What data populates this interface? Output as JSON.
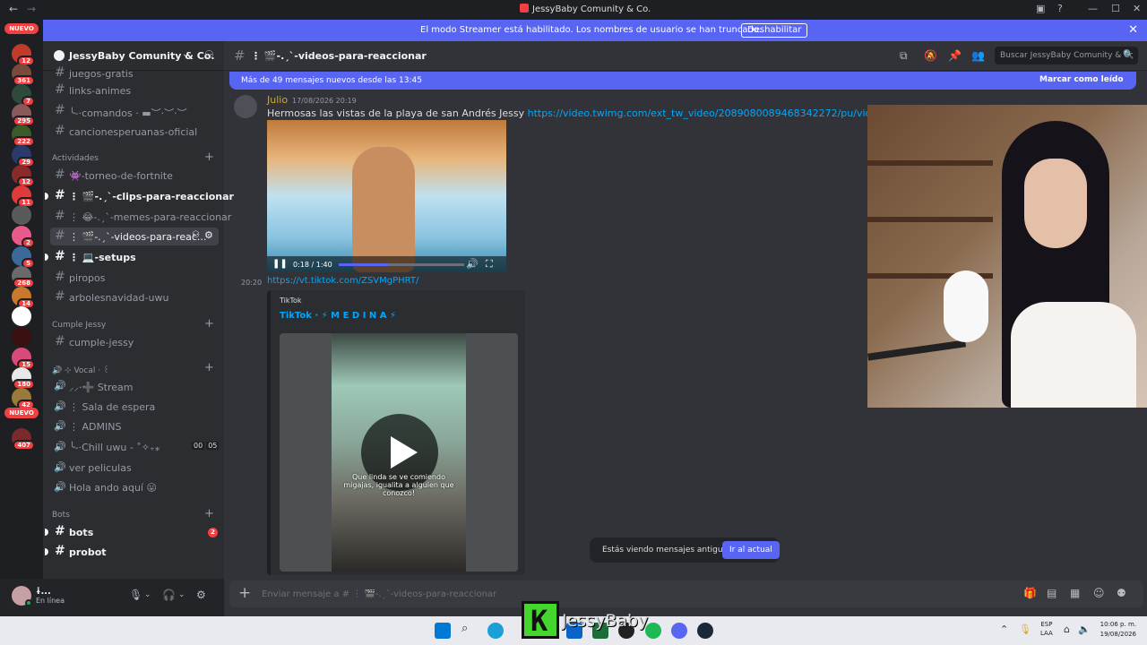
{
  "window": {
    "title": "JessyBaby Comunity & Co."
  },
  "streamer_banner": {
    "text": "El modo Streamer está habilitado. Los nombres de usuario se han truncado.",
    "button": "Deshabilitar"
  },
  "servers": [
    {
      "badge": "NUEVO",
      "type": "tag"
    },
    {
      "badge": "12",
      "color": "#c23a2a"
    },
    {
      "badge": "361",
      "color": "#7a4a3a"
    },
    {
      "badge": "7",
      "color": "#2e4a3a"
    },
    {
      "badge": "295",
      "color": "#8a5a5a"
    },
    {
      "badge": "222",
      "color": "#3a5a2a"
    },
    {
      "badge": "29",
      "color": "#2a3a6a"
    },
    {
      "badge": "12",
      "color": "#8a2a2a"
    },
    {
      "badge": "11",
      "color": "#e03a3a"
    },
    {
      "badge": "",
      "color": "#5a5a5a"
    },
    {
      "badge": "2",
      "color": "#e85a8a"
    },
    {
      "badge": "5",
      "color": "#3a6a9a"
    },
    {
      "badge": "268",
      "color": "#6a6a6a"
    },
    {
      "badge": "14",
      "color": "#c87a2a"
    },
    {
      "badge": "",
      "color": "#ffffff"
    },
    {
      "badge": "",
      "color": "#3a1010"
    },
    {
      "badge": "15",
      "color": "#d84a7a"
    },
    {
      "badge": "180",
      "color": "#e8e8e8"
    },
    {
      "badge": "42",
      "color": "#9a7a3a"
    },
    {
      "badge": "NUEVO",
      "type": "tag"
    },
    {
      "badge": "407",
      "color": "#7a2a2a"
    }
  ],
  "guild": {
    "name": "JessyBaby Comunity & Co."
  },
  "channels": {
    "top": [
      {
        "label": "juegos-gratis"
      },
      {
        "label": "links-animes"
      },
      {
        "label": "╰-·comandos  · ▬︶·︶·︶"
      },
      {
        "label": "cancionesperuanas-oficial"
      }
    ],
    "cat1": "Actividades",
    "act": [
      {
        "label": "👾-torneo-de-fortnite"
      },
      {
        "label": "⋮ 🎬-.ˏˋ-clips-para-reaccionar"
      },
      {
        "label": "⋮ 😂-.ˏˋ-memes-para-reaccionar"
      },
      {
        "label": "⋮ 🎬-.ˏˋ-videos-para-reac..."
      },
      {
        "label": "⋮ 💻-setups"
      },
      {
        "label": "piropos"
      },
      {
        "label": "arbolesnavidad-uwu"
      }
    ],
    "cat2": "Cumple Jessy",
    "cumple": [
      {
        "label": "cumple-jessy"
      }
    ],
    "cat3": "🔊 ⊹ Vocal · ꒰",
    "vocal": [
      {
        "label": "⸝⸝·➕ Stream"
      },
      {
        "label": "⋮ Sala de espera"
      },
      {
        "label": "⋮ ADMINS"
      },
      {
        "label": "╰-·Chill uwu - ˚✧₊⁎"
      },
      {
        "label": "ver peliculas"
      },
      {
        "label": "Hola ando aquí 😛"
      }
    ],
    "vc_counts": [
      "00",
      "05"
    ],
    "cat4": "Bots",
    "bots": [
      {
        "label": "bots",
        "mention": "2"
      },
      {
        "label": "probot"
      }
    ]
  },
  "user": {
    "name": "ɨ...",
    "status": "En línea"
  },
  "channel_header": {
    "name": "⋮ 🎬-.ˏˋ-videos-para-reaccionar",
    "search_placeholder": "Buscar JessyBaby Comunity & Co."
  },
  "new_bar": {
    "left": "Más de 49 mensajes nuevos desde las 13:45",
    "right": "Marcar como leído"
  },
  "message": {
    "author": "Julio",
    "time": "17/08/2026 20:19",
    "text": "Hermosas las vistas de la playa de san Andrés Jessy ",
    "link": "https://video.twimg.com/ext_tw_video/2089080089468342272/pu/vid/avc1/1138x720/JxGFkUI",
    "video_time": "0:18 / 1:40",
    "video_progress": 0.39
  },
  "message2": {
    "time": "20:20",
    "link": "https://vt.tiktok.com/ZSVMgPHRT/",
    "embed_provider": "TikTok",
    "embed_title": "TikTok · ⚡ M E D I N A ⚡",
    "caption": "Que linda se ve comiendo migajas, igualita a alguien que conozco!"
  },
  "toast": {
    "text": "Estás viendo mensajes antiguos",
    "button": "Ir al actual"
  },
  "composer": {
    "placeholder": "Enviar mensaje a # ⋮ 🎬-.ˏˋ-videos-para-reaccionar"
  },
  "overlay": {
    "logo": "K",
    "name": "JessyBaby"
  },
  "taskbar": {
    "lang1": "ESP",
    "lang2": "LAA",
    "time": "10:06 p. m.",
    "date": "19/08/2026"
  }
}
